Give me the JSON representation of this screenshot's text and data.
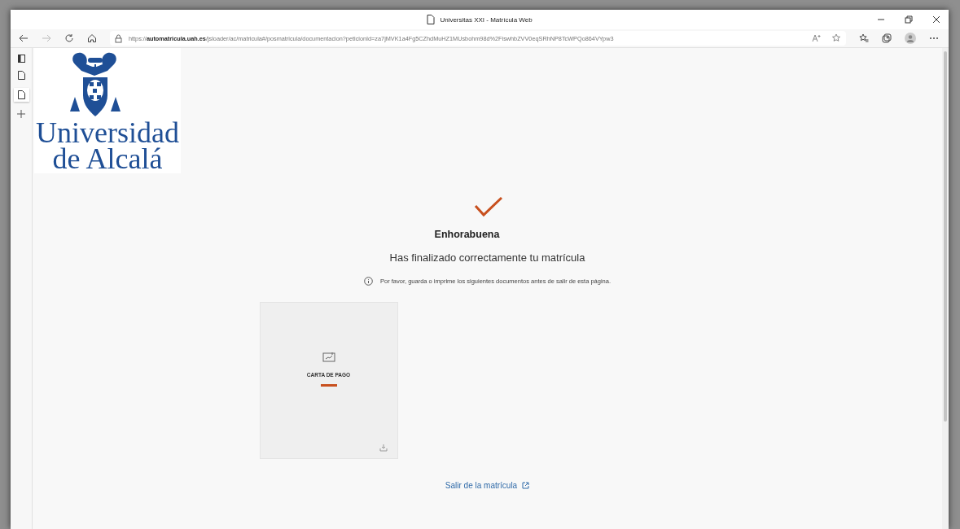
{
  "window": {
    "title": "Universitas XXI - Matrícula Web"
  },
  "address_bar": {
    "url": "https://**automatricula.uah.es**/jsloader/ac/matricula#/posmatricula/documentacion?peticionId=za7jMVK1a4Fg5CZhdMuHZ1MUsbohm98d%2FiswhbZVV0eqSRhNP8TcWPQo864VYpw3"
  },
  "logo": {
    "lines": [
      "Universidad",
      "de Alcalá"
    ]
  },
  "confirmation": {
    "heading": "Enhorabuena",
    "message": "Has finalizado correctamente tu matrícula",
    "notice": "Por favor, guarda o imprime los siguientes documentos antes de salir de esta página."
  },
  "documents": [
    {
      "title": "CARTA DE PAGO"
    }
  ],
  "exit_link": "Salir de la matrícula"
}
